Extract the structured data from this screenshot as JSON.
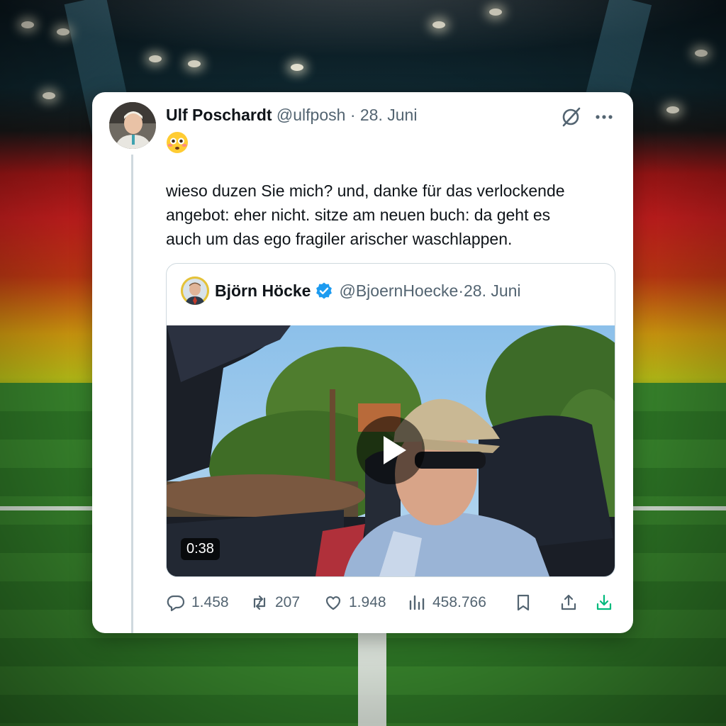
{
  "tweet": {
    "author_name": "Ulf Poschardt",
    "author_handle": "@ulfposh",
    "separator": " · ",
    "date": "28. Juni",
    "emoji": "😳",
    "text_lines": [
      "wieso duzen Sie mich? und, danke für das verlockende",
      "angebot: eher nicht. sitze am neuen buch: da geht es",
      "auch um das ego fragiler arischer waschlappen."
    ]
  },
  "quote": {
    "author_name": "Björn Höcke",
    "author_handle": "@BjoernHoecke",
    "separator": " · ",
    "date": "28. Juni",
    "video_duration": "0:38"
  },
  "actions": {
    "replies": "1.458",
    "reposts": "207",
    "likes": "1.948",
    "views": "458.766"
  },
  "colors": {
    "text": "#0f1419",
    "secondary": "#536471",
    "verified": "#1d9bf0",
    "download": "#00ba7c"
  }
}
